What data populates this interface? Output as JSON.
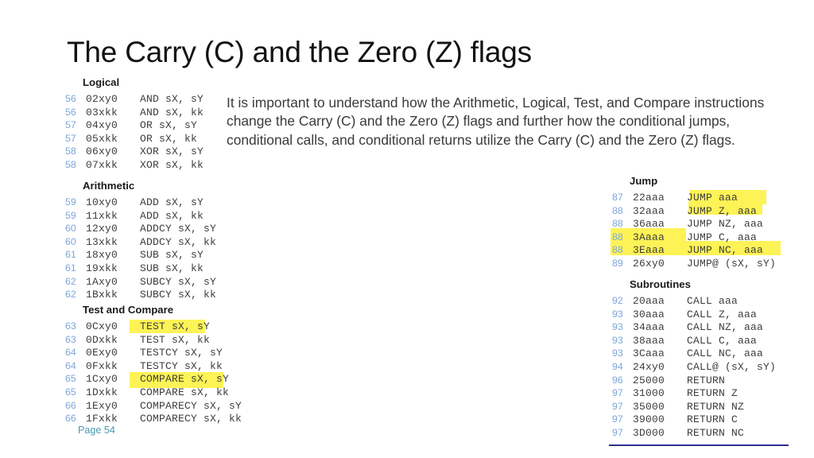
{
  "slide": {
    "title": "The Carry (C) and the Zero (Z) flags",
    "body_paragraph": "It is important to understand how the Arithmetic, Logical, Test, and Compare instructions change the Carry (C) and the Zero (Z) flags and further how the conditional jumps, conditional calls, and conditional returns utilize the Carry (C) and the Zero (Z) flags.",
    "page_label": "Page 54",
    "colors": {
      "highlight": "#fdf356",
      "page_number": "#7ea6d8",
      "page_label": "#4a9ab0",
      "rule": "#2f2f8f",
      "background": "#ffffff"
    }
  },
  "blocks": {
    "logical": {
      "heading": "Logical",
      "rows": [
        {
          "page": "56",
          "code": "02xy0",
          "mnemonic": "AND sX, sY"
        },
        {
          "page": "56",
          "code": "03xkk",
          "mnemonic": "AND sX, kk"
        },
        {
          "page": "57",
          "code": "04xy0",
          "mnemonic": "OR sX, sY"
        },
        {
          "page": "57",
          "code": "05xkk",
          "mnemonic": "OR sX, kk"
        },
        {
          "page": "58",
          "code": "06xy0",
          "mnemonic": "XOR sX, sY"
        },
        {
          "page": "58",
          "code": "07xkk",
          "mnemonic": "XOR sX, kk"
        }
      ]
    },
    "arithmetic": {
      "heading": "Arithmetic",
      "rows": [
        {
          "page": "59",
          "code": "10xy0",
          "mnemonic": "ADD sX, sY"
        },
        {
          "page": "59",
          "code": "11xkk",
          "mnemonic": "ADD sX, kk"
        },
        {
          "page": "60",
          "code": "12xy0",
          "mnemonic": "ADDCY sX, sY"
        },
        {
          "page": "60",
          "code": "13xkk",
          "mnemonic": "ADDCY sX, kk"
        },
        {
          "page": "61",
          "code": "18xy0",
          "mnemonic": "SUB sX, sY"
        },
        {
          "page": "61",
          "code": "19xkk",
          "mnemonic": "SUB sX, kk"
        },
        {
          "page": "62",
          "code": "1Axy0",
          "mnemonic": "SUBCY sX, sY"
        },
        {
          "page": "62",
          "code": "1Bxkk",
          "mnemonic": "SUBCY sX, kk"
        }
      ]
    },
    "test_and_compare": {
      "heading": "Test and Compare",
      "rows": [
        {
          "page": "63",
          "code": "0Cxy0",
          "mnemonic": "TEST sX, sY"
        },
        {
          "page": "63",
          "code": "0Dxkk",
          "mnemonic": "TEST sX, kk"
        },
        {
          "page": "64",
          "code": "0Exy0",
          "mnemonic": "TESTCY sX, sY"
        },
        {
          "page": "64",
          "code": "0Fxkk",
          "mnemonic": "TESTCY sX, kk"
        },
        {
          "page": "65",
          "code": "1Cxy0",
          "mnemonic": "COMPARE sX, sY"
        },
        {
          "page": "65",
          "code": "1Dxkk",
          "mnemonic": "COMPARE sX, kk"
        },
        {
          "page": "66",
          "code": "1Exy0",
          "mnemonic": "COMPARECY sX, sY"
        },
        {
          "page": "66",
          "code": "1Fxkk",
          "mnemonic": "COMPARECY sX, kk"
        }
      ]
    },
    "jump": {
      "heading": "Jump",
      "rows": [
        {
          "page": "87",
          "code": "22aaa",
          "mnemonic": "JUMP aaa"
        },
        {
          "page": "88",
          "code": "32aaa",
          "mnemonic": "JUMP Z, aaa"
        },
        {
          "page": "88",
          "code": "36aaa",
          "mnemonic": "JUMP NZ, aaa"
        },
        {
          "page": "88",
          "code": "3Aaaa",
          "mnemonic": "JUMP C, aaa"
        },
        {
          "page": "88",
          "code": "3Eaaa",
          "mnemonic": "JUMP NC, aaa"
        },
        {
          "page": "89",
          "code": "26xy0",
          "mnemonic": "JUMP@ (sX, sY)"
        }
      ]
    },
    "subroutines": {
      "heading": "Subroutines",
      "rows": [
        {
          "page": "92",
          "code": "20aaa",
          "mnemonic": "CALL aaa"
        },
        {
          "page": "93",
          "code": "30aaa",
          "mnemonic": "CALL Z, aaa"
        },
        {
          "page": "93",
          "code": "34aaa",
          "mnemonic": "CALL NZ, aaa"
        },
        {
          "page": "93",
          "code": "38aaa",
          "mnemonic": "CALL C, aaa"
        },
        {
          "page": "93",
          "code": "3Caaa",
          "mnemonic": "CALL NC, aaa"
        },
        {
          "page": "94",
          "code": "24xy0",
          "mnemonic": "CALL@ (sX, sY)"
        },
        {
          "page": "96",
          "code": "25000",
          "mnemonic": "RETURN"
        },
        {
          "page": "97",
          "code": "31000",
          "mnemonic": "RETURN Z"
        },
        {
          "page": "97",
          "code": "35000",
          "mnemonic": "RETURN NZ"
        },
        {
          "page": "97",
          "code": "39000",
          "mnemonic": "RETURN C"
        },
        {
          "page": "97",
          "code": "3D000",
          "mnemonic": "RETURN NC"
        }
      ]
    }
  }
}
